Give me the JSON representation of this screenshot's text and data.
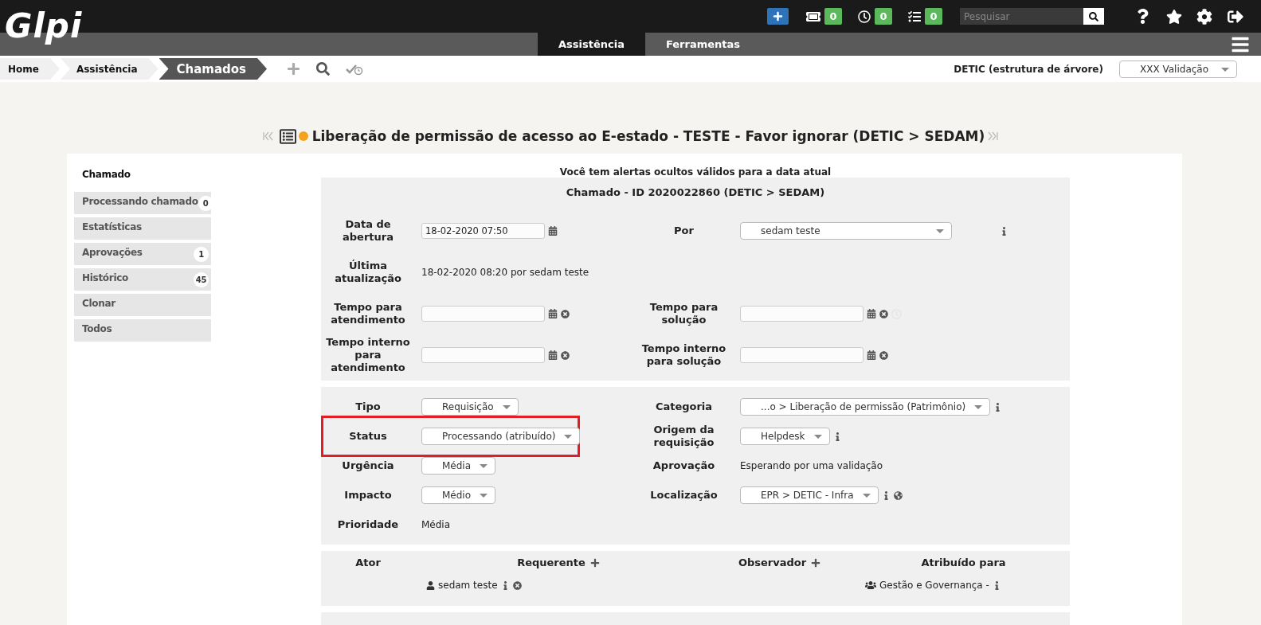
{
  "header": {
    "logo": "Glpi",
    "search": {
      "placeholder": "Pesquisar"
    },
    "counters": [
      {
        "kind": "ticket",
        "count": "0"
      },
      {
        "kind": "clock",
        "count": "0"
      },
      {
        "kind": "tasks",
        "count": "0"
      }
    ],
    "menu": [
      {
        "label": "Assistência",
        "selected": true
      },
      {
        "label": "Ferramentas",
        "selected": false
      }
    ]
  },
  "breadcrumb": [
    {
      "label": "Home",
      "selected": false
    },
    {
      "label": "Assistência",
      "selected": false
    },
    {
      "label": "Chamados",
      "selected": true
    }
  ],
  "entity": {
    "label": "DETIC (estrutura de árvore)",
    "profile": "XXX Validação"
  },
  "title": "Liberação de permissão de acesso ao E-estado - TESTE - Favor ignorar (DETIC > SEDAM)",
  "sidebar": [
    {
      "label": "Chamado",
      "selected": true
    },
    {
      "label": "Processando chamado",
      "selected": false,
      "count": "0"
    },
    {
      "label": "Estatísticas",
      "selected": false
    },
    {
      "label": "Aprovações",
      "selected": false,
      "count": "1"
    },
    {
      "label": "Histórico",
      "selected": false,
      "count": "45"
    },
    {
      "label": "Clonar",
      "selected": false
    },
    {
      "label": "Todos",
      "selected": false
    }
  ],
  "notice": "Você tem alertas ocultos válidos para a data atual",
  "form_sections": [
    {
      "kind": "dates",
      "heading": "Chamado - ID 2020022860 (DETIC > SEDAM)",
      "rows": [
        {
          "left": {
            "label": "Data de abertura",
            "kind": "date",
            "value": "18-02-2020 07:50"
          },
          "right": {
            "label": "Por",
            "kind": "select",
            "value": "sedam teste",
            "info": true
          }
        },
        {
          "left": {
            "label": "Última atualização",
            "kind": "text",
            "value": "18-02-2020 08:20 por sedam teste"
          }
        },
        {
          "left": {
            "label": "Tempo para atendimento",
            "kind": "date",
            "clear": true
          },
          "right": {
            "label": "Tempo para solução",
            "kind": "date",
            "clear": true,
            "clock": true
          }
        },
        {
          "left": {
            "label": "Tempo interno para atendimento",
            "kind": "date",
            "clear": true
          },
          "right": {
            "label": "Tempo interno para solução",
            "kind": "date",
            "clear": true
          }
        }
      ]
    },
    {
      "kind": "details",
      "rows": [
        {
          "left": {
            "label": "Tipo",
            "kind": "select",
            "value": "Requisição"
          },
          "right": {
            "label": "Categoria",
            "kind": "select",
            "value": "...o > Liberação de permissão (Patrimônio)",
            "info": true
          }
        },
        {
          "left": {
            "label": "Status",
            "kind": "select",
            "value": "Processando (atribuído)",
            "highlighted": true
          },
          "right": {
            "label": "Origem da requisição",
            "kind": "select",
            "value": "Helpdesk",
            "info": true
          }
        },
        {
          "left": {
            "label": "Urgência",
            "kind": "select",
            "value": "Média"
          },
          "right": {
            "label": "Aprovação",
            "kind": "text",
            "value": "Esperando por uma validação"
          }
        },
        {
          "left": {
            "label": "Impacto",
            "kind": "select",
            "value": "Médio"
          },
          "right": {
            "label": "Localização",
            "kind": "select",
            "value": "EPR > DETIC - Infra",
            "info": true,
            "globe": true
          }
        },
        {
          "left": {
            "label": "Prioridade",
            "kind": "text",
            "value": "Média"
          }
        }
      ]
    }
  ],
  "actors": {
    "label": "Ator",
    "columns": [
      {
        "heading": "Requerente",
        "add": true,
        "members": [
          {
            "kind": "user",
            "name": "sedam teste",
            "removable": true
          }
        ]
      },
      {
        "heading": "Observador",
        "add": true
      },
      {
        "heading": "Atribuído para",
        "members": [
          {
            "kind": "group",
            "name": "Gestão e Governança -"
          }
        ]
      }
    ]
  }
}
